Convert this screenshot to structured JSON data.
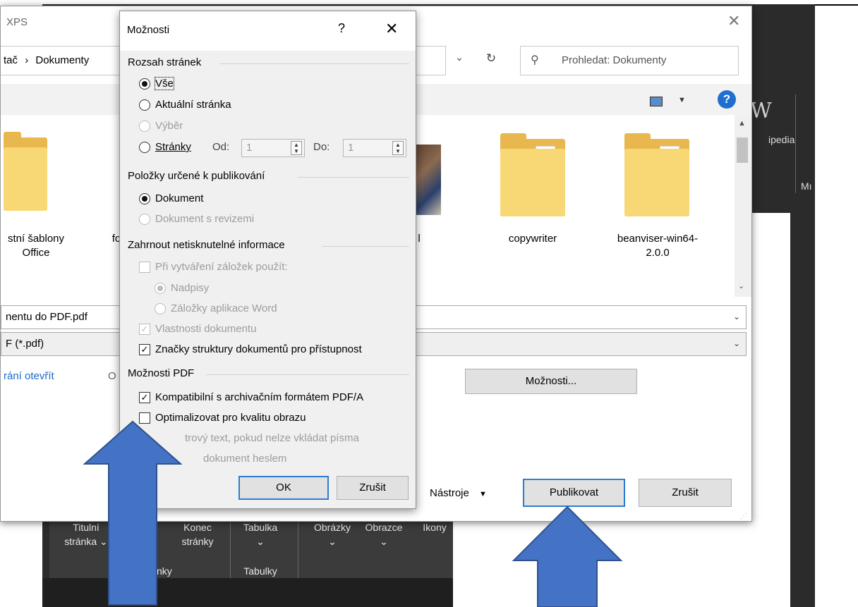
{
  "save_dialog": {
    "title": "XPS",
    "address_prefix": "tač",
    "address_sep": "›",
    "address_current": "Dokumenty",
    "search_placeholder": "Prohledat: Dokumenty",
    "files": [
      {
        "label": "stní šablony Office"
      },
      {
        "label": "fo"
      },
      {
        "label": "l"
      },
      {
        "label": "copywriter"
      },
      {
        "label": "beanviser-win64-2.0.0"
      }
    ],
    "filename_value": "nentu do PDF.pdf",
    "filetype_value": "F (*.pdf)",
    "open_after_link": "rání otevřít",
    "options_partial": "O",
    "options_button": "Možnosti...",
    "tools_label": "Nástroje",
    "publish_button": "Publikovat",
    "cancel_button": "Zrušit"
  },
  "word_ribbon": {
    "title_page": "Titulní stránka",
    "title_page_line1": "Titulní",
    "title_page_line2": "stránka",
    "page_break_line1": "Konec",
    "page_break_line2": "stránky",
    "table": "Tabulka",
    "pictures": "Obrázky",
    "shapes": "Obrazce",
    "icons": "Ikony",
    "group_pages": "Stránky",
    "group_tables": "Tabulky",
    "right_partial_1": "ipedia",
    "right_partial_2": "Mı",
    "right_letter": "W"
  },
  "options_dialog": {
    "title": "Možnosti",
    "help": "?",
    "close": "✕",
    "page_range": {
      "header": "Rozsah stránek",
      "all": "Vše",
      "current": "Aktuální stránka",
      "selection": "Výběr",
      "pages": "Stránky",
      "from_label": "Od:",
      "from_value": "1",
      "to_label": "Do:",
      "to_value": "1",
      "selected": "all"
    },
    "publish_what": {
      "header": "Položky určené k publikování",
      "document": "Dokument",
      "document_markup": "Dokument s revizemi",
      "selected": "document"
    },
    "non_printing": {
      "header": "Zahrnout netisknutelné informace",
      "create_bookmarks": "Při vytváření záložek použít:",
      "headings": "Nadpisy",
      "word_bookmarks": "Záložky aplikace Word",
      "doc_properties": "Vlastnosti dokumentu",
      "structure_tags": "Značky struktury dokumentů pro přístupnost",
      "create_bookmarks_checked": false,
      "doc_properties_checked": true,
      "structure_tags_checked": true
    },
    "pdf_options": {
      "header": "Možnosti PDF",
      "pdfa": "Kompatibilní s archivačním formátem PDF/A",
      "optimize": "Optimalizovat pro kvalitu obrazu",
      "bitmap_text": "trový text, pokud nelze vkládat písma",
      "encrypt": "dokument heslem",
      "pdfa_checked": true
    },
    "ok_button": "OK",
    "cancel_button": "Zrušit"
  },
  "annotations": {
    "arrow_color": "#4472c4",
    "arrow_border": "#2f528f",
    "arrows": [
      "up-arrow",
      "up-arrow"
    ]
  }
}
